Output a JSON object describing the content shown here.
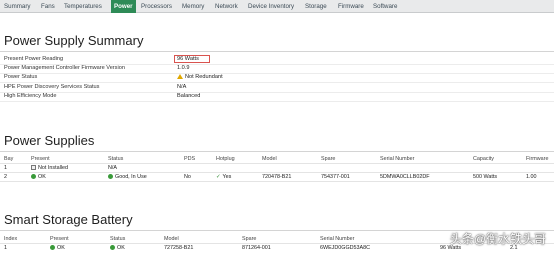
{
  "tabs": [
    "Summary",
    "Fans",
    "Temperatures",
    "Power",
    "Processors",
    "Memory",
    "Network",
    "Device Inventory",
    "Storage",
    "Firmware",
    "Software"
  ],
  "summary": {
    "title": "Power Supply Summary",
    "rows": [
      {
        "label": "Present Power Reading",
        "value": "96 Watts"
      },
      {
        "label": "Power Management Controller Firmware Version",
        "value": "1.0.9"
      },
      {
        "label": "Power Status",
        "value": "Not Redundant"
      },
      {
        "label": "HPE Power Discovery Services Status",
        "value": "N/A"
      },
      {
        "label": "High Efficiency Mode",
        "value": "Balanced"
      }
    ]
  },
  "supplies": {
    "title": "Power Supplies",
    "headers": [
      "Bay",
      "Present",
      "Status",
      "PDS",
      "Hotplug",
      "Model",
      "Spare",
      "Serial Number",
      "Capacity",
      "Firmware"
    ],
    "rows": [
      {
        "bay": "1",
        "present": "Not Installed",
        "status": "N/A",
        "pds": "",
        "hotplug": "",
        "model": "",
        "spare": "",
        "serial": "",
        "capacity": "",
        "firmware": ""
      },
      {
        "bay": "2",
        "present": "OK",
        "status": "Good, In Use",
        "pds": "No",
        "hotplug": "Yes",
        "model": "720478-B21",
        "spare": "754377-001",
        "serial": "5DMWA0CLLB02DF",
        "capacity": "500 Watts",
        "firmware": "1.00"
      }
    ]
  },
  "battery": {
    "title": "Smart Storage Battery",
    "headers": [
      "Index",
      "Present",
      "Status",
      "Model",
      "Spare",
      "Serial Number",
      "Capacity",
      "Firmware"
    ],
    "row": {
      "index": "1",
      "present": "OK",
      "status": "OK",
      "model": "727258-B21",
      "spare": "871264-001",
      "serial": "6WEJD0GGD53A8C",
      "capacity": "96 Watts",
      "firmware": "2.1"
    }
  },
  "watermark": "头条@衡水铁头哥"
}
